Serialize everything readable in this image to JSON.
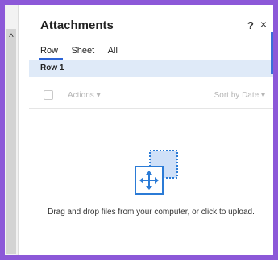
{
  "panel": {
    "title": "Attachments",
    "help_label": "?",
    "close_label": "×",
    "collapse_glyph": "^"
  },
  "tabs": [
    {
      "label": "Row",
      "active": true
    },
    {
      "label": "Sheet",
      "active": false
    },
    {
      "label": "All",
      "active": false
    }
  ],
  "row_label": "Row 1",
  "toolbar": {
    "actions_label": "Actions ▾",
    "sort_label": "Sort by Date ▾"
  },
  "dropzone": {
    "text": "Drag and drop files from your computer, or click to upload.",
    "icon": "move-arrows-icon"
  },
  "colors": {
    "frame_border": "#8c58d8",
    "accent": "#2b63d6",
    "row_highlight": "#dfeaf8"
  }
}
